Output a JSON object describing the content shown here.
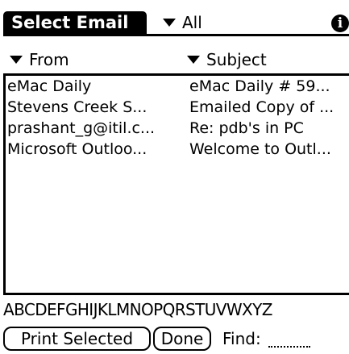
{
  "app": {
    "title": "Select Email",
    "category_label": "All",
    "info_icon": "info-icon",
    "info_glyph": "i"
  },
  "columns": {
    "from_label": "From",
    "subject_label": "Subject"
  },
  "messages": [
    {
      "from": "eMac Daily",
      "subject": "eMac Daily # 59..."
    },
    {
      "from": "Stevens Creek S...",
      "subject": "Emailed Copy of ..."
    },
    {
      "from": "prashant_g@itil.c...",
      "subject": "Re: pdb's in PC"
    },
    {
      "from": "Microsoft Outloo...",
      "subject": "Welcome to Outl..."
    }
  ],
  "alphabet": "ABCDEFGHIJKLMNOPQRSTUVWXYZ",
  "buttons": {
    "print_selected": "Print Selected",
    "done": "Done"
  },
  "find": {
    "label": "Find:",
    "value": ""
  }
}
